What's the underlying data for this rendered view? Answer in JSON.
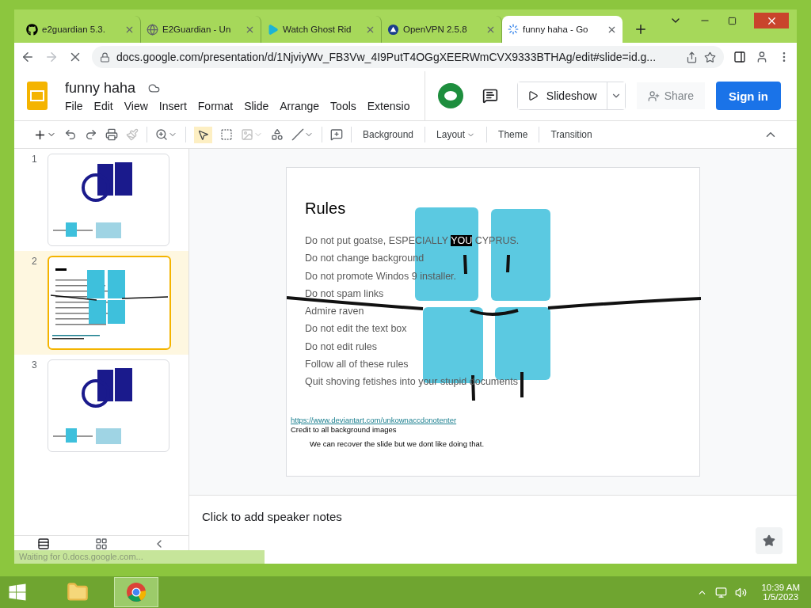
{
  "browser": {
    "tabs": [
      {
        "title": "e2guardian 5.3.",
        "selected": false
      },
      {
        "title": "E2Guardian - Un",
        "selected": false
      },
      {
        "title": "Watch Ghost Rid",
        "selected": false
      },
      {
        "title": "OpenVPN 2.5.8",
        "selected": false
      },
      {
        "title": "funny haha - Go",
        "selected": true
      }
    ],
    "url": "docs.google.com/presentation/d/1NjviyWv_FB3Vw_4I9PutT4OGgXEERWmCVX9333BTHAg/edit#slide=id.g..."
  },
  "doc": {
    "title": "funny haha",
    "menus": [
      "File",
      "Edit",
      "View",
      "Insert",
      "Format",
      "Slide",
      "Arrange",
      "Tools",
      "Extensio"
    ],
    "slideshow_button": "Slideshow",
    "share_button": "Share",
    "signin_button": "Sign in"
  },
  "toolbar": {
    "buttons": [
      "Background",
      "Layout",
      "Theme",
      "Transition"
    ]
  },
  "filmstrip": [
    {
      "number": "1",
      "kind": "picture",
      "selected": false
    },
    {
      "number": "2",
      "kind": "rules",
      "selected": true
    },
    {
      "number": "3",
      "kind": "picture",
      "selected": false
    }
  ],
  "slide": {
    "title": "Rules",
    "rules": [
      {
        "parts": [
          {
            "text": "Do not put goatse, ESPECIALLY ",
            "highlighted": false
          },
          {
            "text": "YOU",
            "highlighted": true
          },
          {
            "text": " CYPRUS.",
            "highlighted": false
          }
        ]
      },
      {
        "parts": [
          {
            "text": "Do not change background",
            "highlighted": false
          }
        ]
      },
      {
        "parts": [
          {
            "text": "Do not promote Windos 9 installer.",
            "highlighted": false
          }
        ]
      },
      {
        "parts": [
          {
            "text": "Do not spam links",
            "highlighted": false
          }
        ]
      },
      {
        "parts": [
          {
            "text": "Admire raven",
            "highlighted": false
          }
        ]
      },
      {
        "parts": [
          {
            "text": "Do not edit the text box",
            "highlighted": false
          }
        ]
      },
      {
        "parts": [
          {
            "text": "Do not edit rules",
            "highlighted": false
          }
        ]
      },
      {
        "parts": [
          {
            "text": "Follow all of these rules",
            "highlighted": false
          }
        ]
      },
      {
        "parts": [
          {
            "text": "Quit shoving fetishes into your stupid documents",
            "highlighted": false
          }
        ]
      }
    ],
    "link": "https://www.deviantart.com/unkownaccdonotenter",
    "credit": "Credit to all background images",
    "note": "We can recover the slide but we dont like doing that."
  },
  "speaker_notes": {
    "placeholder": "Click to add speaker notes"
  },
  "status": "Waiting for 0.docs.google.com...",
  "taskbar": {
    "time": "10:39 AM",
    "date": "1/5/2023"
  }
}
